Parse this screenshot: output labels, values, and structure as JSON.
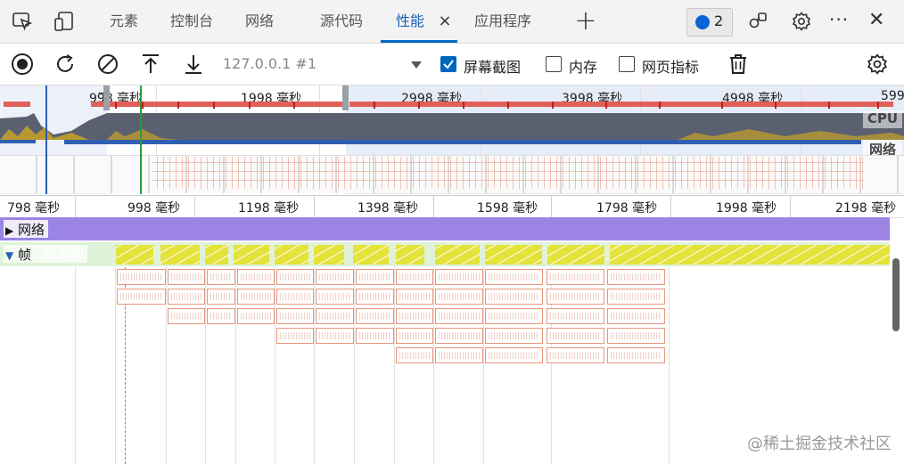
{
  "tabs": [
    {
      "label": "元素"
    },
    {
      "label": "控制台"
    },
    {
      "label": "网络"
    },
    {
      "label": "源代码"
    },
    {
      "label": "性能",
      "active": true
    },
    {
      "label": "应用程序"
    }
  ],
  "tab_close_glyph": "×",
  "add_tab_glyph": "+",
  "issues_badge": {
    "count": "2"
  },
  "more_glyph": "···",
  "close_glyph": "✕",
  "toolbar": {
    "profile_select": "127.0.0.1 #1",
    "screenshots_label": "屏幕截图",
    "screenshots_checked": true,
    "memory_label": "内存",
    "memory_checked": false,
    "web_vitals_label": "网页指标",
    "web_vitals_checked": false
  },
  "overview": {
    "ticks": [
      "99̅8 毫秒",
      "1998 毫秒",
      "2998 毫秒",
      "3998 毫秒",
      "4998 毫秒",
      "599"
    ],
    "cpu_label": "CPU",
    "network_label": "网络"
  },
  "ruler": {
    "ticks": [
      "798 毫秒",
      "998 毫秒",
      "1198 毫秒",
      "1398 毫秒",
      "1598 毫秒",
      "1798 毫秒",
      "1998 毫秒",
      "2198 毫秒"
    ]
  },
  "tracks": {
    "network_label": "网络",
    "frames_label": "帧",
    "frames_value": "0 毫秒"
  },
  "watermark": "@稀土掘金技术社区",
  "colors": {
    "accent": "#0067c0",
    "network_track": "#9b84e3",
    "frames_track": "#dff3d8",
    "frame_bar": "#e5e23a",
    "cpu_band": "#5b6070",
    "net_band": "#2f5fb0"
  },
  "icons": [
    "inspect-icon",
    "device-toggle-icon",
    "record-icon",
    "reload-icon",
    "clear-icon",
    "upload-icon",
    "download-icon",
    "dropdown-arrow-icon",
    "trash-icon",
    "settings-icon",
    "connect-icon",
    "feedback-icon"
  ]
}
